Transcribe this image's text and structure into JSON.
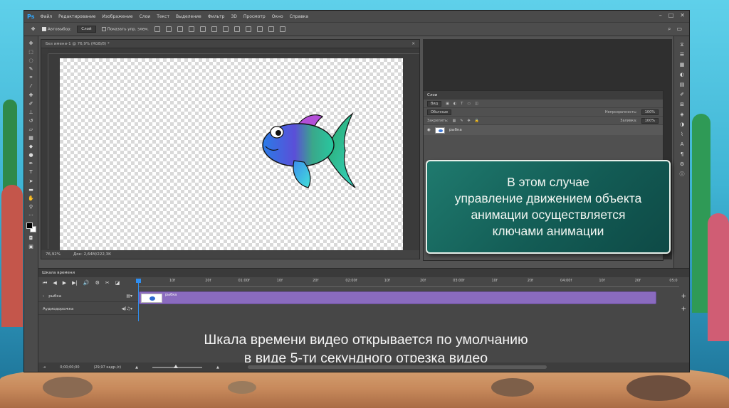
{
  "app": {
    "logo": "Ps",
    "menu": [
      "Файл",
      "Редактирование",
      "Изображение",
      "Слои",
      "Текст",
      "Выделение",
      "Фильтр",
      "3D",
      "Просмотр",
      "Окно",
      "Справка"
    ]
  },
  "options": {
    "autoselect_label": "Автовыбор:",
    "autoselect_value": "Слой",
    "show_controls_label": "Показать упр. элем."
  },
  "document": {
    "tab_title": "Без имени-1 @ 76,9% (RGB/8) *",
    "zoom": "76,92%",
    "doc_size": "Док: 2,64М/222,3К"
  },
  "layers": {
    "tab": "Слои",
    "filter_kind": "Вид",
    "blend_mode": "Обычные",
    "opacity_label": "Непрозрачность:",
    "opacity_value": "100%",
    "lock_label": "Закрепить:",
    "fill_label": "Заливка:",
    "fill_value": "100%",
    "layer_name": "рыбка"
  },
  "callout": {
    "text": "В этом случае\nуправление движением объекта\nанимации осуществляется\nключами анимации"
  },
  "timeline": {
    "tab": "Шкала времени",
    "ticks": [
      "10f",
      "20f",
      "01:00f",
      "10f",
      "20f",
      "02:00f",
      "10f",
      "20f",
      "03:00f",
      "10f",
      "20f",
      "04:00f",
      "10f",
      "20f",
      "05:0"
    ],
    "track_video": "рыбка",
    "track_audio": "Аудиодорожка",
    "clip_label": "рыбка",
    "caption": "Шкала времени видео открывается по умолчанию\nв виде 5-ти секундного отрезка видео",
    "status_timecode": "0;00;00;00",
    "status_fps": "(29,97 кадр./с)"
  },
  "colors": {
    "accent": "#31a8ff",
    "clip": "#8a6bbf",
    "callout": "#135c55"
  }
}
